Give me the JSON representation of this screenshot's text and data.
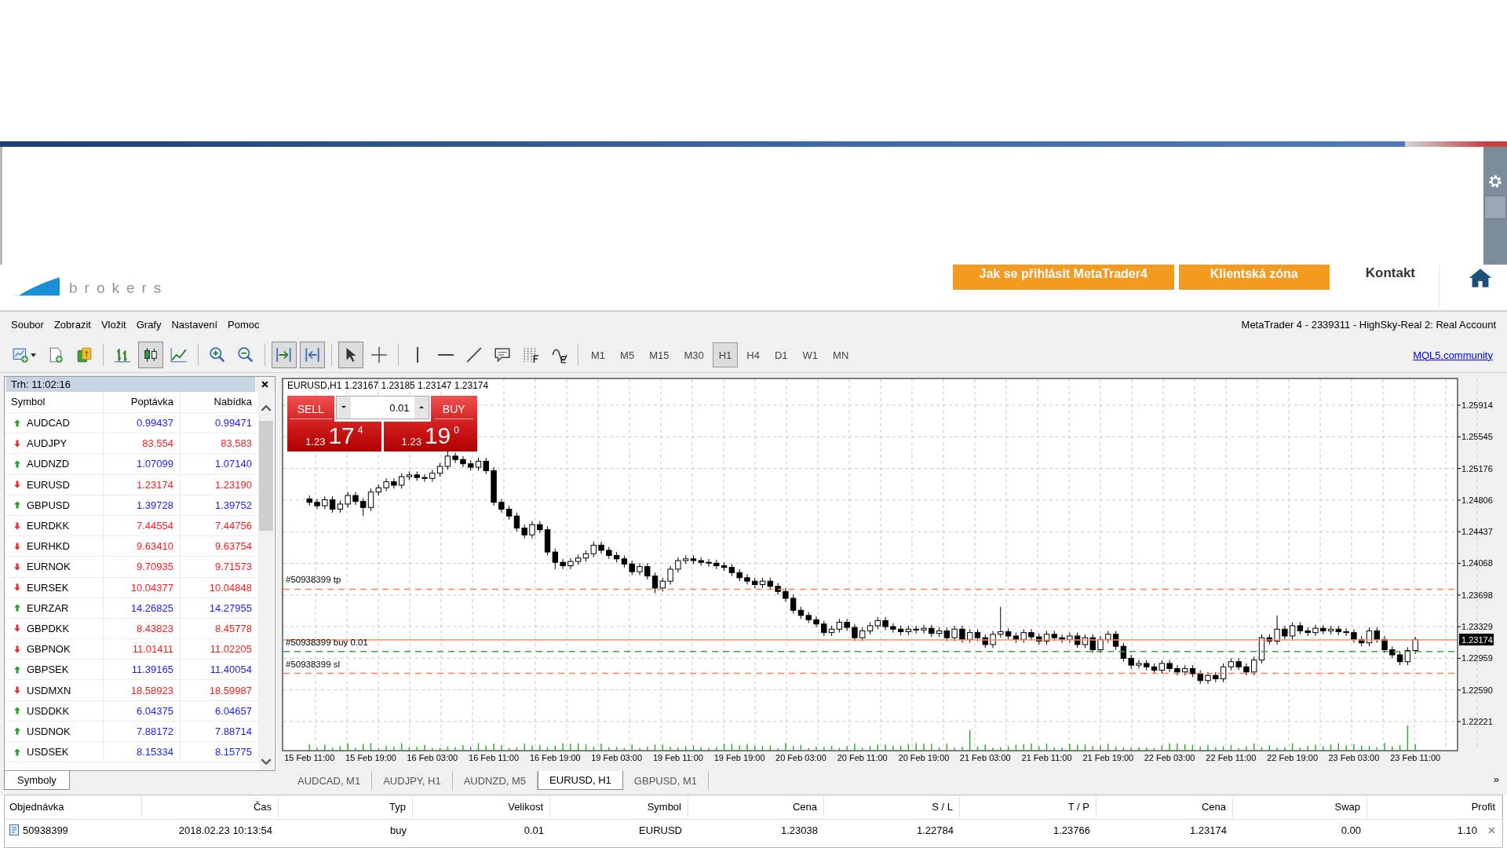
{
  "site_header": {
    "logo_text": "brokers",
    "buttons": [
      "Jak se přihlásit MetaTrader4",
      "Klientská zóna"
    ],
    "link": "Kontakt"
  },
  "menu": {
    "items": [
      "Soubor",
      "Zobrazit",
      "Vložit",
      "Grafy",
      "Nastavení",
      "Pomoc"
    ],
    "title": "MetaTrader 4 - 2339311 - HighSky-Real 2: Real Account"
  },
  "toolbar": {
    "tools": [
      {
        "kind": "new-chart",
        "selected": false
      },
      {
        "kind": "chart-add",
        "selected": false
      },
      {
        "kind": "money",
        "selected": false
      },
      {
        "kind": "bar-chart",
        "selected": false
      },
      {
        "kind": "candlestick",
        "selected": true
      },
      {
        "kind": "line-chart",
        "selected": false
      },
      {
        "kind": "zoom-in",
        "selected": false
      },
      {
        "kind": "zoom-out",
        "selected": false
      },
      {
        "kind": "scroll-end",
        "selected": true
      },
      {
        "kind": "chart-shift",
        "selected": true
      },
      {
        "kind": "cursor",
        "selected": true
      },
      {
        "kind": "crosshair",
        "selected": false
      },
      {
        "kind": "vertical-line",
        "selected": false
      },
      {
        "kind": "horizontal-line",
        "selected": false
      },
      {
        "kind": "trend-line",
        "selected": false
      },
      {
        "kind": "text-label",
        "selected": false
      },
      {
        "kind": "fibonacci",
        "selected": false
      },
      {
        "kind": "indicator",
        "selected": false
      }
    ],
    "timeframes": [
      {
        "label": "M1",
        "selected": false
      },
      {
        "label": "M5",
        "selected": false
      },
      {
        "label": "M15",
        "selected": false
      },
      {
        "label": "M30",
        "selected": false
      },
      {
        "label": "H1",
        "selected": true
      },
      {
        "label": "H4",
        "selected": false
      },
      {
        "label": "D1",
        "selected": false
      },
      {
        "label": "W1",
        "selected": false
      },
      {
        "label": "MN",
        "selected": false
      }
    ],
    "link": "MQL5.community"
  },
  "market_watch": {
    "title": "Trh: 11:02:16",
    "columns": [
      "Symbol",
      "Poptávka",
      "Nabídka"
    ],
    "rows": [
      {
        "symbol": "AUDCAD",
        "rising": true,
        "bid": "0.99437",
        "ask": "0.99471"
      },
      {
        "symbol": "AUDJPY",
        "rising": false,
        "bid": "83.554",
        "ask": "83.583"
      },
      {
        "symbol": "AUDNZD",
        "rising": true,
        "bid": "1.07099",
        "ask": "1.07140"
      },
      {
        "symbol": "EURUSD",
        "rising": false,
        "bid": "1.23174",
        "ask": "1.23190"
      },
      {
        "symbol": "GBPUSD",
        "rising": true,
        "bid": "1.39728",
        "ask": "1.39752"
      },
      {
        "symbol": "EURDKK",
        "rising": false,
        "bid": "7.44554",
        "ask": "7.44756"
      },
      {
        "symbol": "EURHKD",
        "rising": false,
        "bid": "9.63410",
        "ask": "9.63754"
      },
      {
        "symbol": "EURNOK",
        "rising": false,
        "bid": "9.70935",
        "ask": "9.71573"
      },
      {
        "symbol": "EURSEK",
        "rising": false,
        "bid": "10.04377",
        "ask": "10.04848"
      },
      {
        "symbol": "EURZAR",
        "rising": true,
        "bid": "14.26825",
        "ask": "14.27955"
      },
      {
        "symbol": "GBPDKK",
        "rising": false,
        "bid": "8.43823",
        "ask": "8.45778"
      },
      {
        "symbol": "GBPNOK",
        "rising": false,
        "bid": "11.01411",
        "ask": "11.02205"
      },
      {
        "symbol": "GBPSEK",
        "rising": true,
        "bid": "11.39165",
        "ask": "11.40054"
      },
      {
        "symbol": "USDMXN",
        "rising": false,
        "bid": "18.58923",
        "ask": "18.59987"
      },
      {
        "symbol": "USDDKK",
        "rising": true,
        "bid": "6.04375",
        "ask": "6.04657"
      },
      {
        "symbol": "USDNOK",
        "rising": true,
        "bid": "7.88172",
        "ask": "7.88714"
      },
      {
        "symbol": "USDSEK",
        "rising": true,
        "bid": "8.15334",
        "ask": "8.15775"
      }
    ],
    "tab": {
      "label": "Symboly",
      "selected": true
    }
  },
  "chart": {
    "title": "EURUSD,H1  1.23167 1.23185 1.23147 1.23174",
    "trade_panel": {
      "sell": "SELL",
      "buy": "BUY",
      "lot": "0.01",
      "sell_prefix": "1.23",
      "sell_big": "17",
      "sell_small": "4",
      "buy_prefix": "1.23",
      "buy_big": "19",
      "buy_small": "0"
    },
    "chart_data": {
      "type": "candlestick",
      "grid": true,
      "ylim": [
        1.21882,
        1.26226
      ],
      "ref_lines": [
        {
          "axis": "y",
          "value": 1.23766,
          "label": "#50938399 tp",
          "color": "#ff7f50"
        },
        {
          "axis": "y",
          "value": 1.23174,
          "label": "1.23174",
          "color": "#ff8c60"
        },
        {
          "axis": "y",
          "value": 1.23038,
          "label": "#50938399 buy 0.01",
          "color": "#33aa44"
        },
        {
          "axis": "y",
          "value": 1.22784,
          "label": "#50938399 sl",
          "color": "#ff7f50"
        }
      ],
      "yticks": [
        {
          "value": 1.25914,
          "label": "1.25914"
        },
        {
          "value": 1.25545,
          "label": "1.25545"
        },
        {
          "value": 1.25176,
          "label": "1.25176"
        },
        {
          "value": 1.24806,
          "label": "1.24806"
        },
        {
          "value": 1.24437,
          "label": "1.24437"
        },
        {
          "value": 1.24068,
          "label": "1.24068"
        },
        {
          "value": 1.23698,
          "label": "1.23698"
        },
        {
          "value": 1.23329,
          "label": "1.23329"
        },
        {
          "value": 1.22959,
          "label": "1.22959"
        },
        {
          "value": 1.2259,
          "label": "1.22590"
        },
        {
          "value": 1.22221,
          "label": "1.22221"
        }
      ],
      "categories": [
        null,
        null,
        null,
        "15 Feb 11:00",
        null,
        null,
        null,
        null,
        null,
        null,
        null,
        "15 Feb 19:00",
        null,
        null,
        null,
        null,
        null,
        null,
        null,
        "16 Feb 03:00",
        null,
        null,
        null,
        null,
        null,
        null,
        null,
        "16 Feb 11:00",
        null,
        null,
        null,
        null,
        null,
        null,
        null,
        "16 Feb 19:00",
        null,
        null,
        null,
        null,
        null,
        null,
        null,
        "19 Feb 03:00",
        null,
        null,
        null,
        null,
        null,
        null,
        null,
        "19 Feb 11:00",
        null,
        null,
        null,
        null,
        null,
        null,
        null,
        "19 Feb 19:00",
        null,
        null,
        null,
        null,
        null,
        null,
        null,
        "20 Feb 03:00",
        null,
        null,
        null,
        null,
        null,
        null,
        null,
        "20 Feb 11:00",
        null,
        null,
        null,
        null,
        null,
        null,
        null,
        "20 Feb 19:00",
        null,
        null,
        null,
        null,
        null,
        null,
        null,
        "21 Feb 03:00",
        null,
        null,
        null,
        null,
        null,
        null,
        null,
        "21 Feb 11:00",
        null,
        null,
        null,
        null,
        null,
        null,
        null,
        "21 Feb 19:00",
        null,
        null,
        null,
        null,
        null,
        null,
        null,
        "22 Feb 03:00",
        null,
        null,
        null,
        null,
        null,
        null,
        null,
        "22 Feb 11:00",
        null,
        null,
        null,
        null,
        null,
        null,
        null,
        "22 Feb 19:00",
        null,
        null,
        null,
        null,
        null,
        null,
        null,
        "23 Feb 03:00",
        null,
        null,
        null,
        null,
        null,
        null,
        null,
        "23 Feb 11:00",
        null,
        null,
        null,
        null,
        null
      ],
      "ohlc": [
        null,
        null,
        null,
        [
          1.2482,
          1.2486,
          1.2474,
          1.2478
        ],
        [
          1.2478,
          1.2482,
          1.247,
          1.2474
        ],
        [
          1.2474,
          1.2485,
          1.247,
          1.2481
        ],
        [
          1.2481,
          1.2485,
          1.2466,
          1.247
        ],
        [
          1.247,
          1.248,
          1.2466,
          1.2476
        ],
        [
          1.2476,
          1.249,
          1.2472,
          1.2486
        ],
        [
          1.2486,
          1.249,
          1.2475,
          1.2479
        ],
        [
          1.2479,
          1.2483,
          1.2462,
          1.2472
        ],
        [
          1.2472,
          1.2494,
          1.2468,
          1.249
        ],
        [
          1.249,
          1.2499,
          1.2486,
          1.2495
        ],
        [
          1.2495,
          1.2506,
          1.2491,
          1.2502
        ],
        [
          1.2502,
          1.2506,
          1.2494,
          1.2498
        ],
        [
          1.2498,
          1.2512,
          1.2494,
          1.2508
        ],
        [
          1.2508,
          1.2514,
          1.2504,
          1.251
        ],
        [
          1.251,
          1.2514,
          1.2503,
          1.2507
        ],
        [
          1.2507,
          1.2511,
          1.2502,
          1.2506
        ],
        [
          1.2506,
          1.2516,
          1.2502,
          1.2512
        ],
        [
          1.2512,
          1.2524,
          1.2508,
          1.252
        ],
        [
          1.252,
          1.2538,
          1.2516,
          1.2532
        ],
        [
          1.2532,
          1.2536,
          1.2524,
          1.2528
        ],
        [
          1.2528,
          1.2532,
          1.2519,
          1.2523
        ],
        [
          1.2523,
          1.2527,
          1.2515,
          1.2519
        ],
        [
          1.2519,
          1.253,
          1.2515,
          1.2526
        ],
        [
          1.2526,
          1.253,
          1.2511,
          1.2515
        ],
        [
          1.2515,
          1.2519,
          1.2474,
          1.2478
        ],
        [
          1.2478,
          1.2482,
          1.2466,
          1.247
        ],
        [
          1.247,
          1.2474,
          1.2458,
          1.2462
        ],
        [
          1.2462,
          1.2466,
          1.2444,
          1.2448
        ],
        [
          1.2448,
          1.2452,
          1.2436,
          1.244
        ],
        [
          1.244,
          1.2456,
          1.2436,
          1.2452
        ],
        [
          1.2452,
          1.2456,
          1.2442,
          1.2446
        ],
        [
          1.2446,
          1.245,
          1.2416,
          1.242
        ],
        [
          1.242,
          1.2424,
          1.24,
          1.2408
        ],
        [
          1.2408,
          1.2412,
          1.24,
          1.2404
        ],
        [
          1.2404,
          1.2413,
          1.24,
          1.2409
        ],
        [
          1.2409,
          1.2417,
          1.2405,
          1.2413
        ],
        [
          1.2413,
          1.2422,
          1.2409,
          1.2418
        ],
        [
          1.2418,
          1.2432,
          1.2414,
          1.2428
        ],
        [
          1.2428,
          1.2432,
          1.2418,
          1.2422
        ],
        [
          1.2422,
          1.2426,
          1.2412,
          1.2416
        ],
        [
          1.2416,
          1.242,
          1.2408,
          1.2412
        ],
        [
          1.2412,
          1.2416,
          1.2402,
          1.2406
        ],
        [
          1.2406,
          1.241,
          1.2393,
          1.2397
        ],
        [
          1.2397,
          1.2407,
          1.2393,
          1.2403
        ],
        [
          1.2403,
          1.2407,
          1.2388,
          1.2392
        ],
        [
          1.2392,
          1.2396,
          1.2372,
          1.2378
        ],
        [
          1.2378,
          1.239,
          1.2374,
          1.2386
        ],
        [
          1.2386,
          1.2404,
          1.2382,
          1.24
        ],
        [
          1.24,
          1.2414,
          1.2396,
          1.241
        ],
        [
          1.241,
          1.2416,
          1.2406,
          1.2412
        ],
        [
          1.2412,
          1.2416,
          1.2406,
          1.241
        ],
        [
          1.241,
          1.2414,
          1.2404,
          1.2408
        ],
        [
          1.2408,
          1.2412,
          1.2403,
          1.2407
        ],
        [
          1.2407,
          1.2411,
          1.24,
          1.2404
        ],
        [
          1.2404,
          1.2408,
          1.2398,
          1.2402
        ],
        [
          1.2402,
          1.2406,
          1.2392,
          1.2396
        ],
        [
          1.2396,
          1.24,
          1.2386,
          1.239
        ],
        [
          1.239,
          1.2394,
          1.2382,
          1.2386
        ],
        [
          1.2386,
          1.239,
          1.2378,
          1.2382
        ],
        [
          1.2382,
          1.239,
          1.2378,
          1.2386
        ],
        [
          1.2386,
          1.239,
          1.2376,
          1.238
        ],
        [
          1.238,
          1.2384,
          1.237,
          1.2374
        ],
        [
          1.2374,
          1.2378,
          1.2362,
          1.2366
        ],
        [
          1.2366,
          1.237,
          1.2348,
          1.2352
        ],
        [
          1.2352,
          1.2356,
          1.2342,
          1.2346
        ],
        [
          1.2346,
          1.235,
          1.2337,
          1.2341
        ],
        [
          1.2341,
          1.2345,
          1.2332,
          1.2336
        ],
        [
          1.2336,
          1.234,
          1.2322,
          1.2326
        ],
        [
          1.2326,
          1.2334,
          1.2322,
          1.233
        ],
        [
          1.233,
          1.2342,
          1.2326,
          1.2338
        ],
        [
          1.2338,
          1.2342,
          1.2328,
          1.2332
        ],
        [
          1.2332,
          1.2336,
          1.2316,
          1.232
        ],
        [
          1.232,
          1.2332,
          1.2316,
          1.2328
        ],
        [
          1.2328,
          1.2338,
          1.2324,
          1.2334
        ],
        [
          1.2334,
          1.2344,
          1.233,
          1.234
        ],
        [
          1.234,
          1.2344,
          1.2329,
          1.2333
        ],
        [
          1.2333,
          1.2337,
          1.2326,
          1.233
        ],
        [
          1.233,
          1.2334,
          1.2323,
          1.2327
        ],
        [
          1.2327,
          1.2334,
          1.2323,
          1.233
        ],
        [
          1.233,
          1.2334,
          1.2325,
          1.2329
        ],
        [
          1.2329,
          1.2335,
          1.2325,
          1.2331
        ],
        [
          1.2331,
          1.2335,
          1.2321,
          1.2325
        ],
        [
          1.2325,
          1.2332,
          1.2321,
          1.2328
        ],
        [
          1.2328,
          1.2332,
          1.2316,
          1.232
        ],
        [
          1.232,
          1.2334,
          1.2316,
          1.233
        ],
        [
          1.233,
          1.2334,
          1.2314,
          1.2318
        ],
        [
          1.2318,
          1.233,
          1.2314,
          1.2326
        ],
        [
          1.2326,
          1.233,
          1.2316,
          1.232
        ],
        [
          1.232,
          1.2324,
          1.2308,
          1.2312
        ],
        [
          1.2312,
          1.2328,
          1.2308,
          1.2324
        ],
        [
          1.2324,
          1.2356,
          1.232,
          1.2327
        ],
        [
          1.2327,
          1.2331,
          1.2318,
          1.2322
        ],
        [
          1.2322,
          1.2326,
          1.2314,
          1.2318
        ],
        [
          1.2318,
          1.233,
          1.2314,
          1.2326
        ],
        [
          1.2326,
          1.233,
          1.2317,
          1.2321
        ],
        [
          1.2321,
          1.2325,
          1.2312,
          1.2316
        ],
        [
          1.2316,
          1.2328,
          1.2312,
          1.2324
        ],
        [
          1.2324,
          1.2328,
          1.2316,
          1.232
        ],
        [
          1.232,
          1.2324,
          1.2314,
          1.2318
        ],
        [
          1.2318,
          1.2326,
          1.2314,
          1.2322
        ],
        [
          1.2322,
          1.2326,
          1.2308,
          1.2312
        ],
        [
          1.2312,
          1.2324,
          1.2308,
          1.232
        ],
        [
          1.232,
          1.2324,
          1.2302,
          1.2306
        ],
        [
          1.2306,
          1.2322,
          1.2302,
          1.2318
        ],
        [
          1.2318,
          1.2328,
          1.2314,
          1.2324
        ],
        [
          1.2324,
          1.2328,
          1.2306,
          1.231
        ],
        [
          1.231,
          1.2314,
          1.2292,
          1.2296
        ],
        [
          1.2296,
          1.23,
          1.2284,
          1.2288
        ],
        [
          1.2288,
          1.2294,
          1.2284,
          1.229
        ],
        [
          1.229,
          1.2294,
          1.2282,
          1.2286
        ],
        [
          1.2286,
          1.229,
          1.2278,
          1.2282
        ],
        [
          1.2282,
          1.2294,
          1.2278,
          1.229
        ],
        [
          1.229,
          1.2294,
          1.228,
          1.2284
        ],
        [
          1.2284,
          1.2288,
          1.2276,
          1.228
        ],
        [
          1.228,
          1.2288,
          1.2276,
          1.2284
        ],
        [
          1.2284,
          1.2288,
          1.2274,
          1.2278
        ],
        [
          1.2278,
          1.2282,
          1.2266,
          1.227
        ],
        [
          1.227,
          1.228,
          1.2266,
          1.2276
        ],
        [
          1.2276,
          1.228,
          1.2268,
          1.2272
        ],
        [
          1.2272,
          1.229,
          1.2268,
          1.2286
        ],
        [
          1.2286,
          1.2296,
          1.2282,
          1.2292
        ],
        [
          1.2292,
          1.2296,
          1.2282,
          1.2286
        ],
        [
          1.2286,
          1.229,
          1.2276,
          1.228
        ],
        [
          1.228,
          1.2298,
          1.2276,
          1.2294
        ],
        [
          1.2294,
          1.2324,
          1.229,
          1.232
        ],
        [
          1.232,
          1.2324,
          1.2312,
          1.2316
        ],
        [
          1.2316,
          1.2346,
          1.2312,
          1.233
        ],
        [
          1.233,
          1.2334,
          1.2318,
          1.2322
        ],
        [
          1.2322,
          1.2338,
          1.2318,
          1.2334
        ],
        [
          1.2334,
          1.2338,
          1.2324,
          1.2328
        ],
        [
          1.2328,
          1.2332,
          1.2322,
          1.2326
        ],
        [
          1.2326,
          1.2335,
          1.2322,
          1.2331
        ],
        [
          1.2331,
          1.2335,
          1.2324,
          1.2328
        ],
        [
          1.2328,
          1.2334,
          1.2324,
          1.233
        ],
        [
          1.233,
          1.2334,
          1.2323,
          1.2327
        ],
        [
          1.2327,
          1.2331,
          1.2322,
          1.2326
        ],
        [
          1.2326,
          1.233,
          1.2314,
          1.2318
        ],
        [
          1.2318,
          1.2322,
          1.231,
          1.2314
        ],
        [
          1.2314,
          1.2332,
          1.231,
          1.2328
        ],
        [
          1.2328,
          1.2332,
          1.2314,
          1.2318
        ],
        [
          1.2318,
          1.2322,
          1.2302,
          1.2306
        ],
        [
          1.2306,
          1.231,
          1.2296,
          1.23
        ],
        [
          1.23,
          1.2304,
          1.2288,
          1.2292
        ],
        [
          1.2292,
          1.2309,
          1.2288,
          1.2305
        ],
        [
          1.2305,
          1.2321,
          1.2301,
          1.2318
        ],
        null,
        null,
        null,
        null,
        null
      ]
    }
  },
  "chart_tabs": [
    {
      "label": "AUDCAD, M1",
      "selected": false
    },
    {
      "label": "AUDJPY, H1",
      "selected": false
    },
    {
      "label": "AUDNZD, M5",
      "selected": false
    },
    {
      "label": "EURUSD, H1",
      "selected": true
    },
    {
      "label": "GBPUSD, M1",
      "selected": false
    }
  ],
  "tabs_more": "»",
  "terminal": {
    "columns": [
      "Objednávka",
      "Čas",
      "Typ",
      "Velikost",
      "Symbol",
      "Cena",
      "S / L",
      "T / P",
      "Cena",
      "Swap",
      "Profit"
    ],
    "rows": [
      {
        "cells": [
          "50938399",
          "2018.02.23 10:13:54",
          "buy",
          "0.01",
          "EURUSD",
          "1.23038",
          "1.22784",
          "1.23766",
          "1.23174",
          "0.00",
          "1.10"
        ]
      }
    ]
  }
}
